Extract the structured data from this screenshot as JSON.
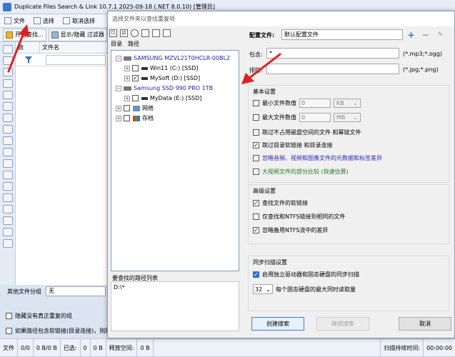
{
  "main": {
    "title": "Duplicate Files Search & Link 10.7.1 2025-09-18 (.NET 8.0.10) [管理员]",
    "menu": [
      {
        "label": "文件"
      },
      {
        "label": "选择"
      },
      {
        "label": "取消选择"
      }
    ],
    "toolbar": {
      "start_search": "开始查找...",
      "show_hide_filter": "显示/隐藏 过滤器"
    },
    "grid": {
      "col_count": "数",
      "col_filename": "文件名"
    },
    "bottom": {
      "other_groups_label": "其他文件分组",
      "other_groups_value": "无",
      "hide_groups": "隐藏没有真正重复的组",
      "path_contains_link": "如果路径包含软链接(目录连接)，则隐藏"
    },
    "status": {
      "file_label": "文件",
      "files_count": "0/0",
      "files_size": "0 B/0 B",
      "selected_label": "已选:",
      "selected_count": "0",
      "selected_size": "0 B",
      "freed_label": "释放空间:",
      "freed_size": "0 B",
      "scan_time_label": "扫描持续时间:",
      "scan_time": "00:00:00"
    }
  },
  "dialog": {
    "title": "选择文件夹以查找重复项",
    "tabs": [
      "目录",
      "路径"
    ],
    "tree": {
      "disk1": "SAMSUNG MZVL21T0HCLR-00BL2",
      "disk1_part1": "Win11 (C:) [SSD]",
      "disk1_part2": "MySoft (D:) [SSD]",
      "disk2": "Samsung SSD 990 PRO 1TB",
      "disk2_part1": "MyData (E:) [SSD]",
      "network": "网络",
      "storage": "存档"
    },
    "paths_label": "要查找的路径列表",
    "paths_value": "D:\\*",
    "config": {
      "label": "配置文件:",
      "value": "默认配置文件"
    },
    "include": {
      "label": "包含:",
      "value": "*",
      "hint": "(*.mp3;*.ogg)"
    },
    "exclude": {
      "label": "排除:",
      "value": "",
      "hint": "(*.jpg;*.png)"
    },
    "basic": {
      "title": "基本设置",
      "min_size": "最小文件数值",
      "min_value": "0",
      "min_unit": "KB",
      "max_size": "最大文件数值",
      "max_value": "0",
      "max_unit": "MB",
      "skip_unused": "跳过不占用磁盘空间的文件 和幂链文件",
      "skip_links": "跳过目录软链接 和目录连接",
      "ignore_meta": "忽略音频、视频和图像文件的元数据和标签差异",
      "partial_compare": "大视频文件的部分比较 (快速估算)"
    },
    "advanced": {
      "title": "高级设置",
      "find_symlinks": "查找文件的软链接",
      "only_ntfs": "仅查找和NTFS链接到相同的文件",
      "ignore_ads": "忽略备用NTFS流中的差异"
    },
    "sync": {
      "title": "同步扫描设置",
      "enable_sync": "启用独立驱动器和固态硬盘的同步扫描",
      "ssd_count": "32",
      "ssd_label": "每个固态硬盘的最大同时读取量"
    },
    "buttons": {
      "create": "创建搜索",
      "continue": "继续搜索",
      "cancel": "取消"
    }
  },
  "colors": {
    "accent": "#2f6fd8",
    "disk_label": "#2222a8",
    "arrow": "#e02020",
    "link_blue": "#2a2ab0",
    "green_text": "#1f7a1f"
  }
}
